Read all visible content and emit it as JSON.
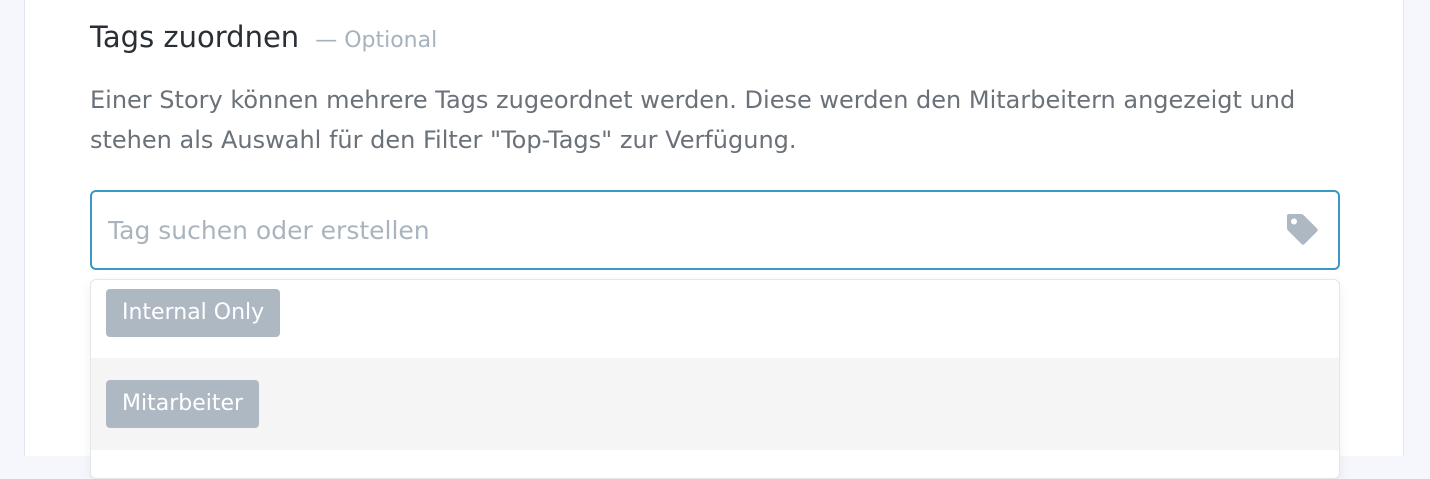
{
  "section": {
    "title": "Tags zuordnen",
    "optional": "— Optional",
    "description": "Einer Story können mehrere Tags zugeordnet werden. Diese werden den Mitarbeitern angezeigt und stehen als Auswahl für den Filter \"Top-Tags\" zur Verfügung."
  },
  "tag_search": {
    "value": "",
    "placeholder": "Tag suchen oder erstellen",
    "icon": "tag-icon"
  },
  "suggestions": [
    {
      "label": "Internal Only"
    },
    {
      "label": "Mitarbeiter"
    }
  ],
  "colors": {
    "focus_border": "#3a98c6",
    "tag_pill": "#aeb8c2",
    "icon": "#aeb8c2"
  }
}
